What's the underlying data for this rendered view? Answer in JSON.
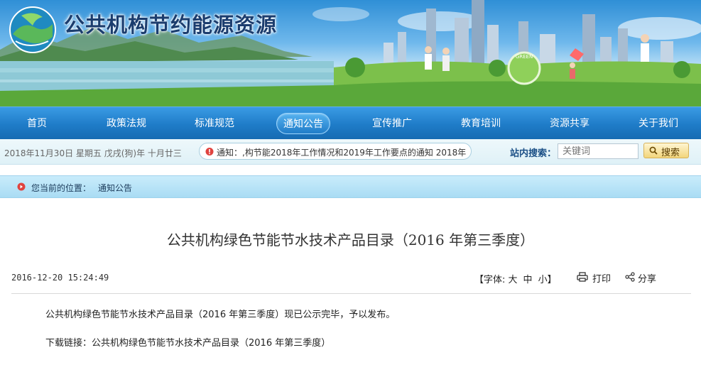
{
  "header": {
    "site_title": "公共机构节约能源资源",
    "logo_icon": "globe-leaf-logo-icon"
  },
  "nav": {
    "items": [
      {
        "label": "首页"
      },
      {
        "label": "政策法规"
      },
      {
        "label": "标准规范"
      },
      {
        "label": "通知公告",
        "active": true
      },
      {
        "label": "宣传推广"
      },
      {
        "label": "教育培训"
      },
      {
        "label": "资源共享"
      },
      {
        "label": "关于我们"
      }
    ]
  },
  "infobar": {
    "date_text": "2018年11月30日  星期五  戊戌(狗)年  十月廿三",
    "notice_text": "通知：,构节能2018年工作情况和2019年工作要点的通知      2018年",
    "search_label": "站内搜索：",
    "search_placeholder": "关键词",
    "search_button": "搜索"
  },
  "breadcrumb": {
    "prefix": "您当前的位置：",
    "current": "通知公告"
  },
  "article": {
    "title": "公共机构绿色节能节水技术产品目录（2016 年第三季度）",
    "datetime": "2016-12-20 15:24:49",
    "font_label": "【字体:",
    "font_large": "大",
    "font_medium": "中",
    "font_small": "小",
    "font_close": "】",
    "print_label": "打印",
    "share_label": "分享",
    "paragraph_1": "公共机构绿色节能节水技术产品目录（2016 年第三季度）现已公示完毕，予以发布。",
    "download_prefix": "下载链接：",
    "download_link": "公共机构绿色节能节水技术产品目录（2016 年第三季度）"
  },
  "colors": {
    "nav_blue": "#1f7cc8",
    "title_navy": "#1b3d6e",
    "crumb_bg": "#b9e3f7"
  }
}
